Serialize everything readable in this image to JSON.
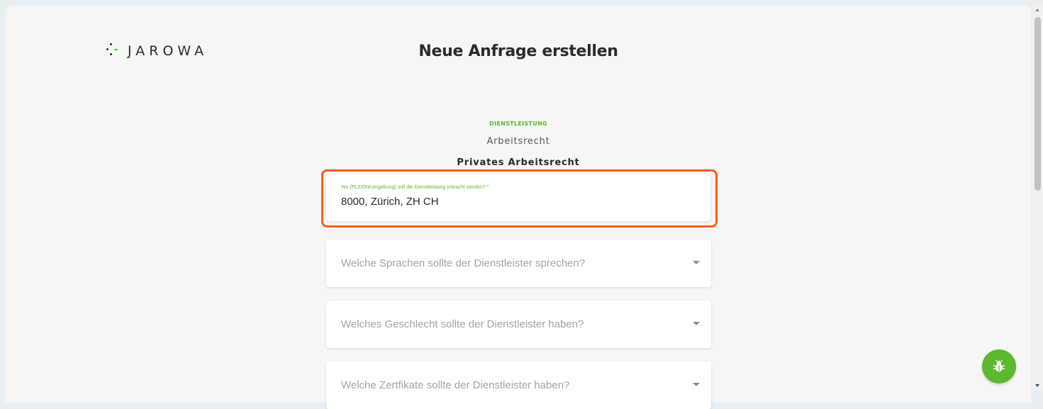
{
  "brand": {
    "name": "JAROWA"
  },
  "header": {
    "title": "Neue Anfrage erstellen"
  },
  "service": {
    "section_label": "DIENSTLEISTUNG",
    "category": "Arbeitsrecht",
    "subcategory": "Privates Arbeitsrecht"
  },
  "form": {
    "location": {
      "label": "Wo (PLZ/Ort/Umgebung) soll die Dienstleistung erbracht werden? *",
      "value": "8000, Zürich, ZH CH"
    },
    "languages": {
      "placeholder": "Welche Sprachen sollte der Dienstleister sprechen?"
    },
    "gender": {
      "placeholder": "Welches Geschlecht sollte der Dienstleister haben?"
    },
    "certificates": {
      "placeholder": "Welche Zertfikate sollte der Dienstleister haben?"
    }
  },
  "colors": {
    "accent": "#5cb82e",
    "highlight": "#ff5a1f",
    "background": "#f6f6f5"
  },
  "icons": {
    "logo": "dots-logo-icon",
    "dropdown": "caret-down-icon",
    "feedback": "bug-icon"
  }
}
